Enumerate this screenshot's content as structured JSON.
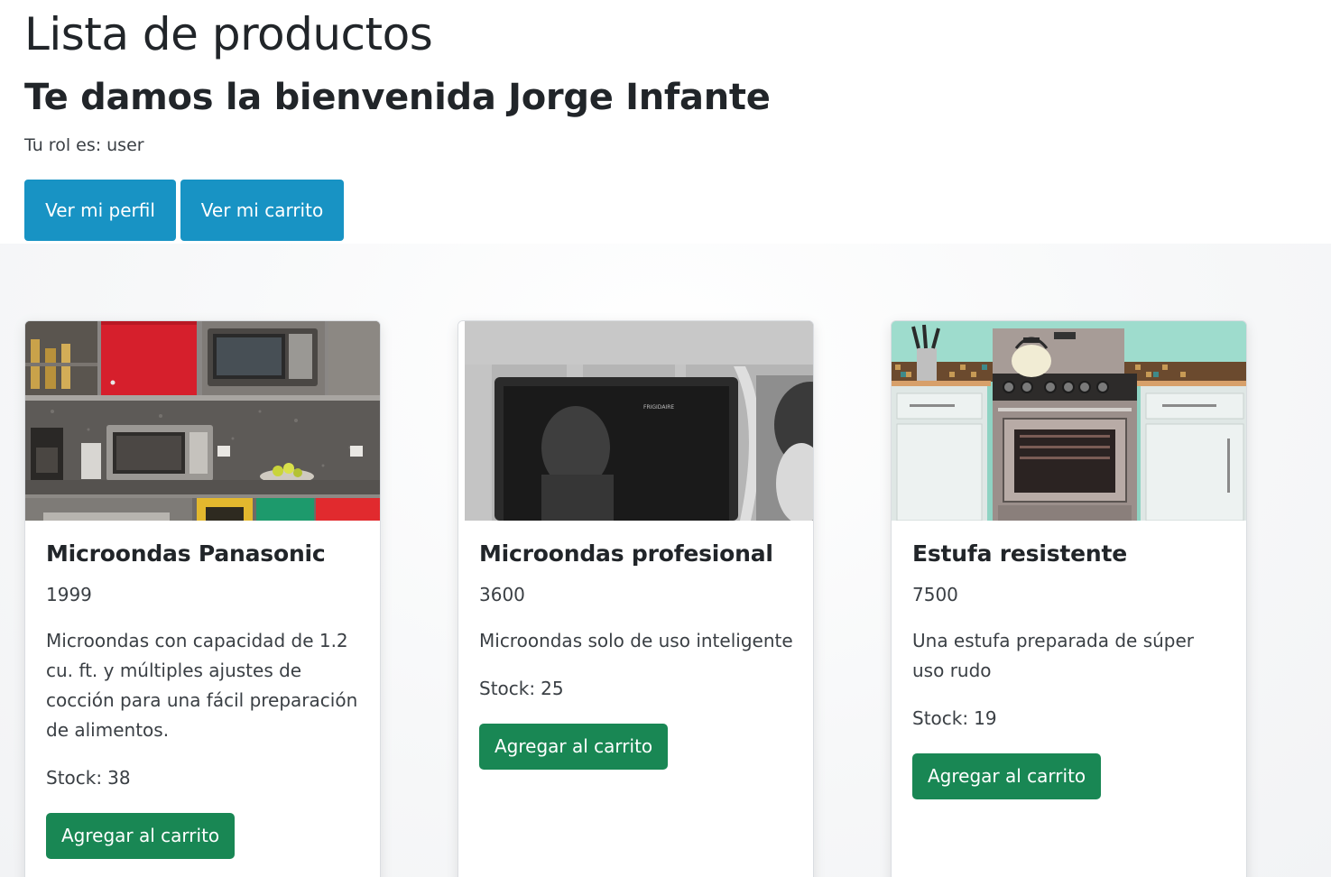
{
  "header": {
    "title": "Lista de productos",
    "welcome": "Te damos la bienvenida Jorge Infante",
    "role_label": "Tu rol es:",
    "role_value": "user"
  },
  "actions": {
    "profile_label": "Ver mi perfil",
    "cart_label": "Ver mi carrito"
  },
  "products": [
    {
      "name": "Microondas Panasonic",
      "price": "1999",
      "description": "Microondas con capacidad de 1.2 cu. ft. y múltiples ajustes de cocción para una fácil preparación de alimentos.",
      "stock_label": "Stock:",
      "stock": "38",
      "add_label": "Agregar al carrito"
    },
    {
      "name": "Microondas profesional",
      "price": "3600",
      "description": "Microondas solo de uso inteligente",
      "stock_label": "Stock:",
      "stock": "25",
      "add_label": "Agregar al carrito"
    },
    {
      "name": "Estufa resistente",
      "price": "7500",
      "description": "Una estufa preparada de súper uso rudo",
      "stock_label": "Stock:",
      "stock": "19",
      "add_label": "Agregar al carrito"
    }
  ],
  "colors": {
    "info_button": "#1893c4",
    "success_button": "#198754",
    "text": "#212529"
  }
}
